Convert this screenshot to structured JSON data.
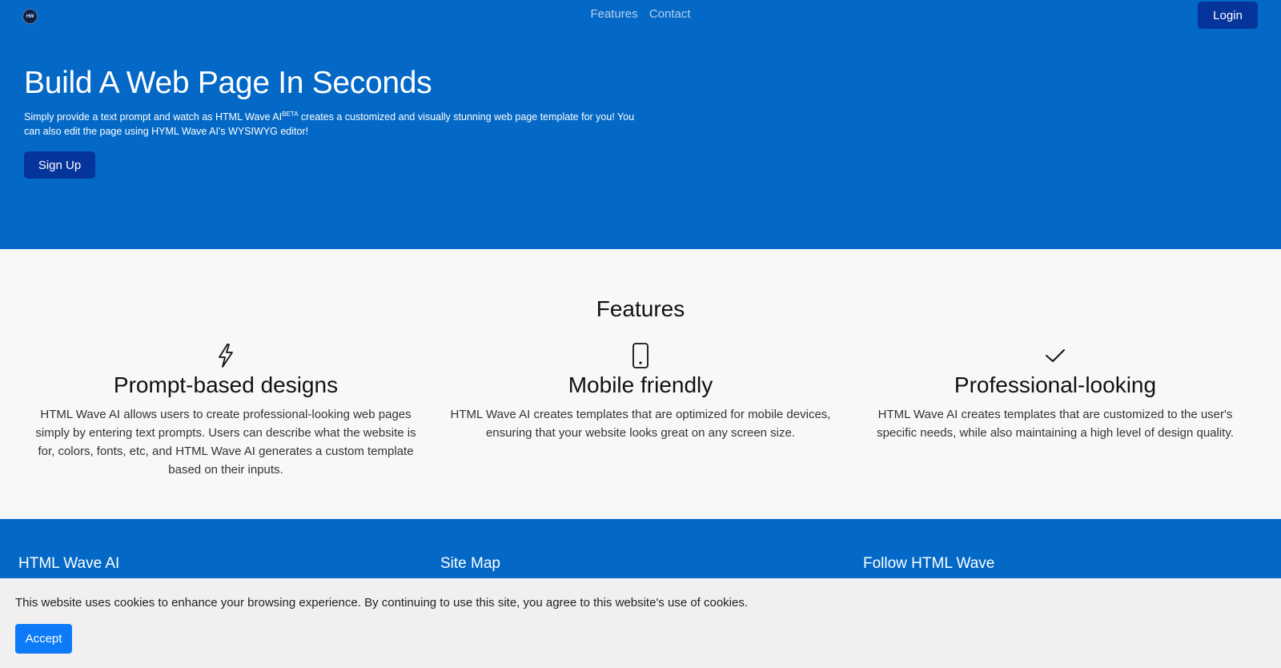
{
  "nav": {
    "logo_text": "HW",
    "links": [
      "Features",
      "Contact"
    ],
    "login_label": "Login",
    "bg_color": "#0368c6"
  },
  "hero": {
    "title": "Build A Web Page In Seconds",
    "desc_before": "Simply provide a text prompt and watch as HTML Wave AI",
    "desc_sup": "BETA",
    "desc_after": " creates a customized and visually stunning web page template for you! You can also edit the page using HYML Wave AI's WYSIWYG editor!",
    "signup_label": "Sign Up"
  },
  "features": {
    "title": "Features",
    "items": [
      {
        "icon": "lightning-icon",
        "title": "Prompt-based designs",
        "text": "HTML Wave AI allows users to create professional-looking web pages simply by entering text prompts. Users can describe what the website is for, colors, fonts, etc, and HTML Wave AI generates a custom template based on their inputs."
      },
      {
        "icon": "phone-icon",
        "title": "Mobile friendly",
        "text": "HTML Wave AI creates templates that are optimized for mobile devices, ensuring that your website looks great on any screen size."
      },
      {
        "icon": "check-icon",
        "title": "Professional-looking",
        "text": "HTML Wave AI creates templates that are customized to the user's specific needs, while also maintaining a high level of design quality."
      }
    ]
  },
  "footer": {
    "columns": [
      "HTML Wave AI",
      "Site Map",
      "Follow HTML Wave"
    ]
  },
  "cookie": {
    "message": "This website uses cookies to enhance your browsing experience. By continuing to use this site, you agree to this website's use of cookies.",
    "accept_label": "Accept",
    "accent_color": "#0d7bf8"
  }
}
